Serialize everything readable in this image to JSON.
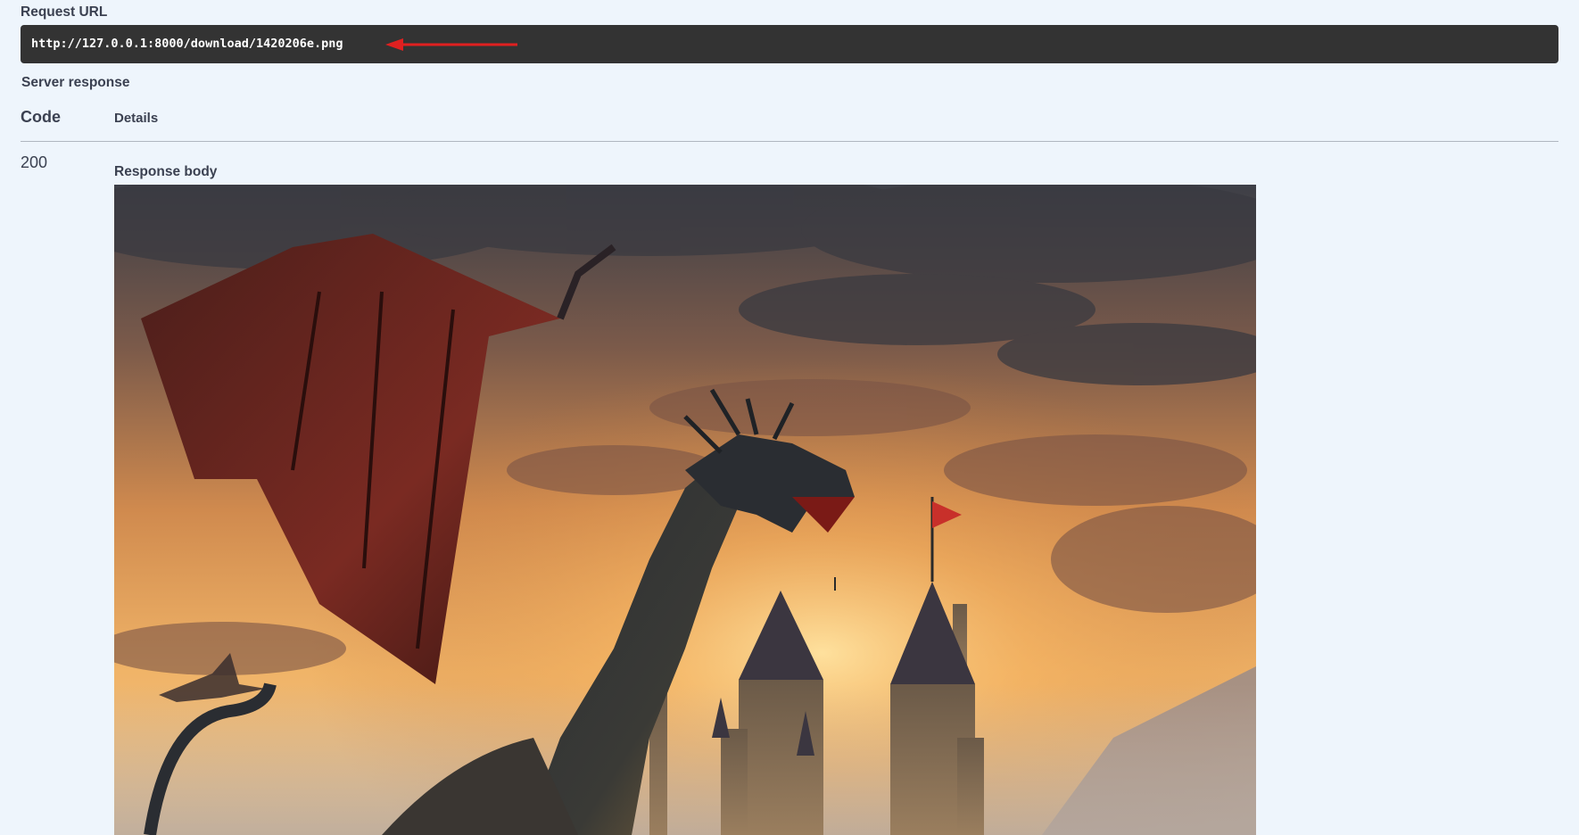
{
  "request": {
    "label": "Request URL",
    "url": "http://127.0.0.1:8000/download/1420206e.png"
  },
  "server_response": {
    "label": "Server response",
    "columns": {
      "code": "Code",
      "details": "Details"
    },
    "rows": [
      {
        "code": "200",
        "body_label": "Response body"
      }
    ]
  },
  "colors": {
    "url_box_bg": "#333333",
    "page_bg": "#eef5fc",
    "annotation_arrow": "#e02020"
  },
  "icons": {
    "annotation": "red-arrow-left-icon"
  }
}
